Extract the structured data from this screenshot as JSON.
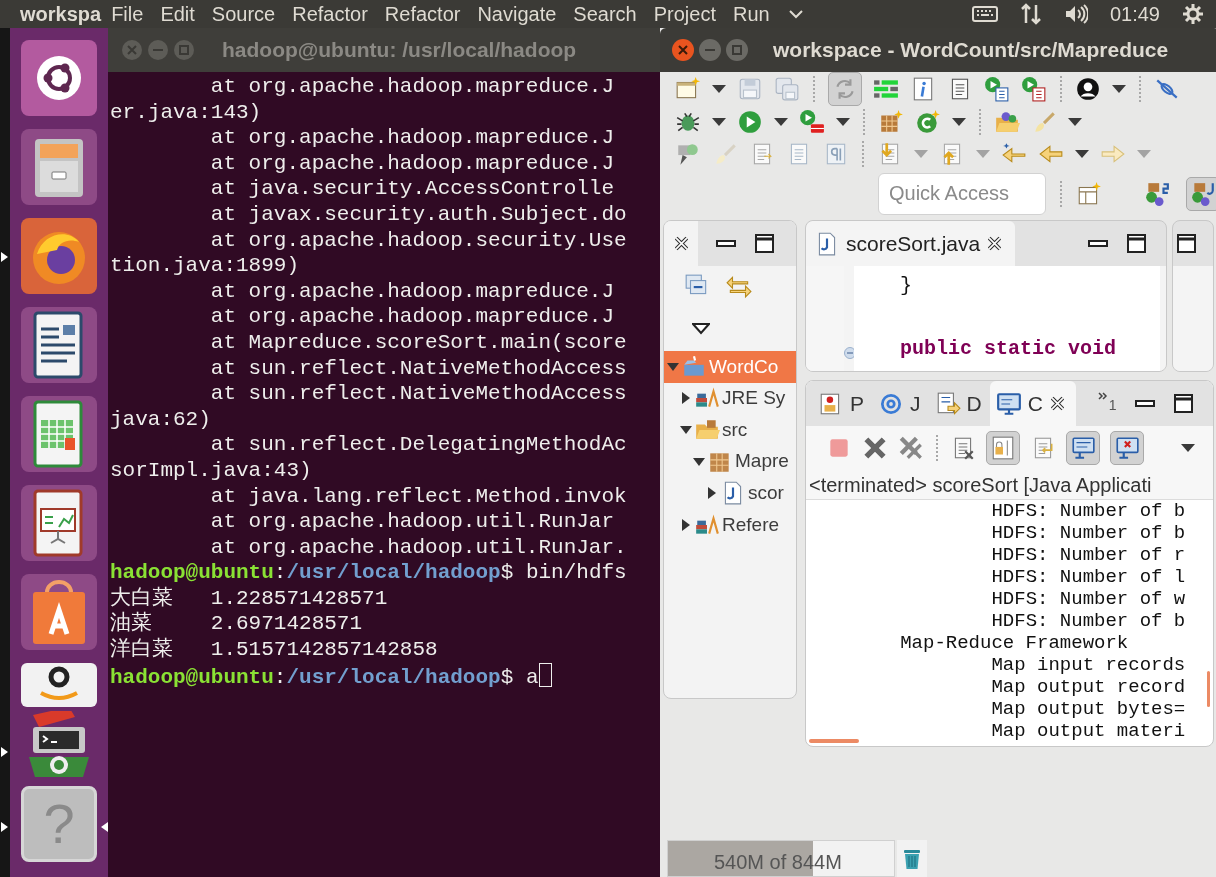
{
  "top_bar": {
    "app_name": "workspa",
    "menu": [
      "File",
      "Edit",
      "Source",
      "Refactor",
      "Refactor",
      "Navigate",
      "Search",
      "Project",
      "Run"
    ],
    "clock": "01:49"
  },
  "launcher": [
    {
      "kind": "dash",
      "running": false,
      "focused": false
    },
    {
      "kind": "files",
      "running": false,
      "focused": false
    },
    {
      "kind": "firefox",
      "running": true,
      "focused": false
    },
    {
      "kind": "writer",
      "running": false,
      "focused": false
    },
    {
      "kind": "calc",
      "running": false,
      "focused": false
    },
    {
      "kind": "impress",
      "running": false,
      "focused": false
    },
    {
      "kind": "software",
      "running": false,
      "focused": false
    },
    {
      "kind": "amazon",
      "running": false,
      "focused": false
    },
    {
      "kind": "stack",
      "running": true,
      "focused": false
    },
    {
      "kind": "help",
      "label": "?",
      "running": true,
      "focused": true
    }
  ],
  "terminal": {
    "title": "hadoop@ubuntu: /usr/local/hadoop",
    "lines": [
      {
        "kind": "trace",
        "text": "at org.apache.hadoop.mapreduce.J"
      },
      {
        "kind": "wrap",
        "text": "er.java:143)"
      },
      {
        "kind": "trace",
        "text": "at org.apache.hadoop.mapreduce.J"
      },
      {
        "kind": "trace",
        "text": "at org.apache.hadoop.mapreduce.J"
      },
      {
        "kind": "trace",
        "text": "at java.security.AccessControlle"
      },
      {
        "kind": "trace",
        "text": "at javax.security.auth.Subject.do"
      },
      {
        "kind": "trace",
        "text": "at org.apache.hadoop.security.Use"
      },
      {
        "kind": "wrap",
        "text": "tion.java:1899)"
      },
      {
        "kind": "trace",
        "text": "at org.apache.hadoop.mapreduce.J"
      },
      {
        "kind": "trace",
        "text": "at org.apache.hadoop.mapreduce.J"
      },
      {
        "kind": "trace",
        "text": "at Mapreduce.scoreSort.main(score"
      },
      {
        "kind": "trace",
        "text": "at sun.reflect.NativeMethodAccess"
      },
      {
        "kind": "trace",
        "text": "at sun.reflect.NativeMethodAccess"
      },
      {
        "kind": "wrap",
        "text": "java:62)"
      },
      {
        "kind": "trace",
        "text": "at sun.reflect.DelegatingMethodAc"
      },
      {
        "kind": "wrap",
        "text": "sorImpl.java:43)"
      },
      {
        "kind": "trace",
        "text": "at java.lang.reflect.Method.invok"
      },
      {
        "kind": "trace",
        "text": "at org.apache.hadoop.util.RunJar"
      },
      {
        "kind": "trace",
        "text": "at org.apache.hadoop.util.RunJar."
      },
      {
        "kind": "prompt",
        "user": "hadoop@ubuntu",
        "separator": ":",
        "path": "/usr/local/hadoop",
        "command": "$ bin/hdfs",
        "cursor": false
      },
      {
        "kind": "output",
        "key": "大白菜",
        "value": "1.228571428571"
      },
      {
        "kind": "output",
        "key": "油菜",
        "value": "2.6971428571"
      },
      {
        "kind": "output",
        "key": "洋白菜",
        "value": "1.5157142857142858"
      },
      {
        "kind": "prompt",
        "user": "hadoop@ubuntu",
        "separator": ":",
        "path": "/usr/local/hadoop",
        "command": "$ a",
        "cursor": true
      }
    ]
  },
  "eclipse": {
    "title": "workspace - WordCount/src/Mapreduce",
    "toolbar": {
      "sync_pressed": true
    },
    "quick_access": {
      "placeholder": "Quick Access"
    },
    "perspectives": [
      {
        "kind": "javaee",
        "selected": false
      },
      {
        "kind": "java",
        "selected": true
      }
    ],
    "package_explorer": {
      "tree": [
        {
          "label": "WordCo",
          "kind": "project",
          "selected": true,
          "expanded": true,
          "children": [
            {
              "label": "JRE Sy",
              "kind": "library",
              "selected": false,
              "expanded": false
            },
            {
              "label": "src",
              "kind": "folder",
              "selected": false,
              "expanded": true,
              "children": [
                {
                  "label": "Mapre",
                  "kind": "package",
                  "selected": false,
                  "expanded": true,
                  "children": [
                    {
                      "label": "scor",
                      "kind": "java",
                      "selected": false,
                      "expanded": false
                    }
                  ]
                }
              ]
            },
            {
              "label": "Refere",
              "kind": "library",
              "selected": false,
              "expanded": false
            }
          ]
        }
      ]
    },
    "editor": {
      "tab": "scoreSort.java",
      "code": [
        {
          "kind": "plain",
          "text": "}"
        },
        {
          "kind": "keyword",
          "text": "public static void"
        }
      ]
    },
    "console": {
      "tabs": [
        {
          "label": "P",
          "kind": "problems",
          "selected": false
        },
        {
          "label": "J",
          "kind": "javadoc",
          "selected": false
        },
        {
          "label": "D",
          "kind": "declaration",
          "selected": false
        },
        {
          "label": "C",
          "kind": "console",
          "selected": true
        }
      ],
      "overflow_count": "1",
      "toggles": {
        "scroll_lock": true,
        "show_on_output": true,
        "show_on_error": true
      },
      "header": "<terminated> scoreSort [Java Applicati",
      "lines": [
        {
          "kind": "counter",
          "text": "HDFS: Number of b"
        },
        {
          "kind": "counter",
          "text": "HDFS: Number of b"
        },
        {
          "kind": "counter",
          "text": "HDFS: Number of r"
        },
        {
          "kind": "counter",
          "text": "HDFS: Number of l"
        },
        {
          "kind": "counter",
          "text": "HDFS: Number of w"
        },
        {
          "kind": "counter",
          "text": "HDFS: Number of b"
        },
        {
          "kind": "group",
          "text": "Map-Reduce Framework"
        },
        {
          "kind": "counter",
          "text": "Map input records"
        },
        {
          "kind": "counter",
          "text": "Map output record"
        },
        {
          "kind": "counter",
          "text": "Map output bytes="
        },
        {
          "kind": "counter",
          "text": "Map output materi"
        }
      ]
    },
    "heap": {
      "text": "540M of 844M",
      "level": 0.64
    }
  }
}
